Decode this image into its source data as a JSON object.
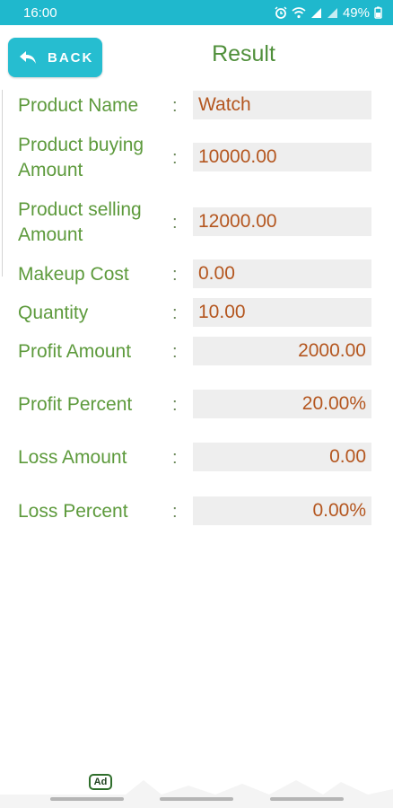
{
  "status_bar": {
    "time": "16:00",
    "battery": "49%",
    "icons": [
      "alarm-icon",
      "wifi-icon",
      "signal-icon",
      "signal-icon",
      "battery-icon"
    ]
  },
  "header": {
    "back_label": "BACK",
    "title": "Result"
  },
  "rows": [
    {
      "label": "Product Name",
      "value": "Watch"
    },
    {
      "label": "Product buying Amount",
      "value": "10000.00"
    },
    {
      "label": "Product selling Amount",
      "value": "12000.00"
    },
    {
      "label": "Makeup Cost",
      "value": "0.00"
    },
    {
      "label": "Quantity",
      "value": "10.00"
    },
    {
      "label": "Profit Amount",
      "value": "2000.00"
    },
    {
      "label": "Profit Percent",
      "value": "20.00%"
    },
    {
      "label": "Loss Amount",
      "value": "0.00"
    },
    {
      "label": "Loss Percent",
      "value": "0.00%"
    }
  ],
  "separator": ":",
  "ad": {
    "badge": "Ad"
  },
  "colors": {
    "status_bar": "#1fb8cd",
    "back_button": "#26bdd0",
    "label_green": "#5d9a3c",
    "value_orange": "#b4561f",
    "value_bg": "#eeeeee"
  }
}
